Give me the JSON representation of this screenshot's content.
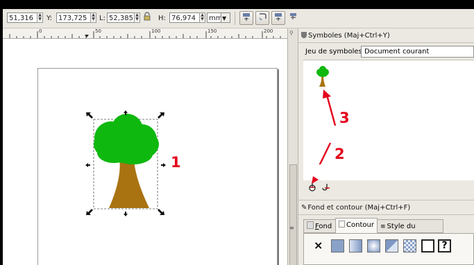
{
  "toolbar": {
    "x_value": "51,316",
    "y_label": "Y:",
    "y_value": "173,725",
    "w_label": "L:",
    "w_value": "52,385",
    "lock_icon": "lock-icon",
    "h_label": "H:",
    "h_value": "76,974",
    "unit": "mm",
    "arrow_glyph": "▼"
  },
  "ruler": {
    "ticks": [
      "0",
      "50",
      "100",
      "150",
      "200"
    ]
  },
  "canvas": {
    "annotation_1": "1",
    "tree_colors": {
      "foliage": "#0fb80f",
      "trunk": "#a97312"
    }
  },
  "symbols_dialog": {
    "title": "Symboles (Maj+Ctrl+Y)",
    "set_label": "Jeu de symboles :",
    "set_value": "Document courant",
    "annotation_2": "2",
    "annotation_3": "3"
  },
  "fill_stroke_dialog": {
    "title": "Fond et contour (Maj+Ctrl+F)",
    "tabs": {
      "fill_underlined_letter": "F",
      "fill_rest": "ond",
      "stroke": "Contour",
      "stroke_style_prefix": "Style du co",
      "stroke_style_underlined_letter": "n",
      "stroke_style_suffix": "tour"
    },
    "none_glyph": "×",
    "unknown_glyph": "?"
  },
  "colors": {
    "annotation_red": "#e3001b",
    "panel_bg": "#ece9e3"
  }
}
